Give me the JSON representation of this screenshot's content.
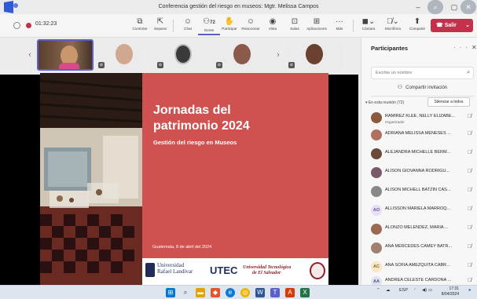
{
  "window": {
    "title": "Conferencia gestión del riesgo en museos: Mgtr. Melissa Campos"
  },
  "toolbar": {
    "timer": "01:32:23",
    "items": [
      {
        "label": "Controlar",
        "icon": "screen-share-control-icon"
      },
      {
        "label": "Separar",
        "icon": "pop-out-icon"
      },
      {
        "label": "Chat",
        "icon": "chat-icon"
      },
      {
        "label": "Gente",
        "icon": "people-icon",
        "badge": "72"
      },
      {
        "label": "Participar",
        "icon": "raise-hand-icon"
      },
      {
        "label": "Reaccionar",
        "icon": "reaction-icon"
      },
      {
        "label": "Vista",
        "icon": "view-icon"
      },
      {
        "label": "Salas",
        "icon": "rooms-icon"
      },
      {
        "label": "Aplicaciones",
        "icon": "apps-icon"
      },
      {
        "label": "Más",
        "icon": "more-icon"
      },
      {
        "label": "Cámara",
        "icon": "camera-off-icon"
      },
      {
        "label": "Micrófono",
        "icon": "mic-off-icon"
      },
      {
        "label": "Compartir",
        "icon": "share-icon"
      }
    ],
    "leave_label": "Salir"
  },
  "slide": {
    "title_line1": "Jornadas del",
    "title_line2": "patrimonio 2024",
    "subtitle": "Gestión del riesgo en Museos",
    "date": "Guatemala, 8 de abril del 2024",
    "logo1_line1": "Universidad",
    "logo1_line2": "Rafael Landívar",
    "logo2": "UTEC",
    "logo3_line1": "Universidad Tecnológica",
    "logo3_line2": "de El Salvador"
  },
  "panel": {
    "title": "Participantes",
    "search_placeholder": "Escribe un nombre",
    "invite_label": "Compartir invitación",
    "in_meeting": "En esta reunión (72)",
    "mute_all": "Silenciar a todos",
    "participants": [
      {
        "name": "RAMIREZ KLEE, NELLY ELIZABE...",
        "role": "Organizador",
        "avatar": "photo",
        "color": "#8b5a3c"
      },
      {
        "name": "ADRIANA MELISSA MENESES ...",
        "role": "",
        "avatar": "photo",
        "color": "#b07060"
      },
      {
        "name": "ALEJANDRA MICHELLE BERM...",
        "role": "",
        "avatar": "photo",
        "color": "#6a4a3a"
      },
      {
        "name": "ALISON GIOVANNA RODRIGU...",
        "role": "",
        "avatar": "photo",
        "color": "#7a5a6a"
      },
      {
        "name": "ALISON MICHELL BATZIN CAS...",
        "role": "",
        "avatar": "photo",
        "color": "#888"
      },
      {
        "name": "ALLISSON MARIELA MARROQ...",
        "role": "",
        "avatar": "AO",
        "color": "#e8dff5"
      },
      {
        "name": "ALONZO MELENDEZ, MARIA ...",
        "role": "",
        "avatar": "photo",
        "color": "#9a6a50"
      },
      {
        "name": "ANA MERCEDES CAMEY BATR...",
        "role": "",
        "avatar": "photo",
        "color": "#a08070"
      },
      {
        "name": "ANA SOFIA AMEZQUITA CABR...",
        "role": "",
        "avatar": "AC",
        "color": "#f7e6c8"
      },
      {
        "name": "ANDREA CELESTE CARDONA ...",
        "role": "",
        "avatar": "AA",
        "color": "#dfe3f0"
      }
    ]
  },
  "taskbar": {
    "lang": "ESP",
    "time": "17:31",
    "date": "8/04/2024"
  }
}
